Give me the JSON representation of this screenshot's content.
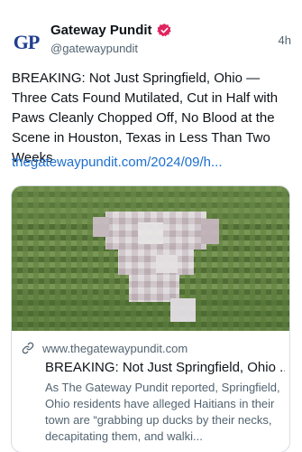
{
  "account": {
    "display_name": "Gateway Pundit",
    "handle": "@gatewaypundit",
    "avatar_text": "GP",
    "time": "4h"
  },
  "post": {
    "text": "BREAKING: Not Just Springfield, Ohio — Three Cats Found Mutilated, Cut in Half with Paws Cleanly Chopped Off, No Blood at the Scene in Houston, Texas in Less Than Two Weeks",
    "link": "thegatewaypundit.com/2024/09/h..."
  },
  "card": {
    "domain": "www.thegatewaypundit.com",
    "title": "BREAKING: Not Just Springfield, Ohio ...",
    "description": "As The Gateway Pundit reported, Springfield, Ohio residents have alleged Haitians in their town are “grabbing up ducks by their necks, decapitating them, and walki...",
    "image_icon": "blurred-photo"
  },
  "icons": {
    "verified": "verified-badge-icon",
    "link": "link-icon"
  },
  "colors": {
    "verified_badge": "#e0245e",
    "link": "#1d6fcf",
    "secondary_text": "#536471",
    "brand_avatar": "#1f3e8f"
  }
}
